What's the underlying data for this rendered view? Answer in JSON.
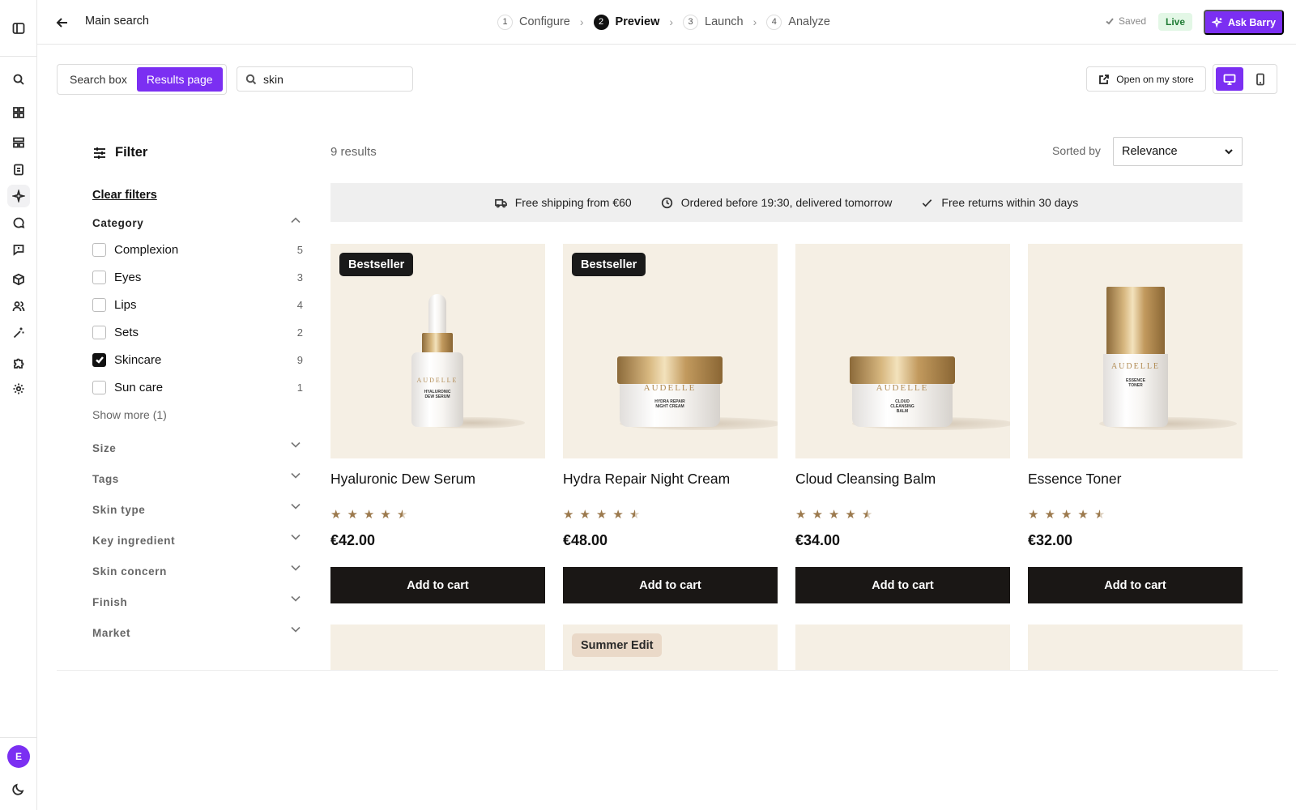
{
  "header": {
    "title": "Main search",
    "steps": [
      {
        "num": "1",
        "label": "Configure"
      },
      {
        "num": "2",
        "label": "Preview"
      },
      {
        "num": "3",
        "label": "Launch"
      },
      {
        "num": "4",
        "label": "Analyze"
      }
    ],
    "saved": "Saved",
    "live": "Live",
    "ask": "Ask Barry"
  },
  "toolbar": {
    "tabs": [
      "Search box",
      "Results page"
    ],
    "search_value": "skin",
    "open_store": "Open on my store"
  },
  "sidebar_icons": [
    "panel-icon",
    "search-icon",
    "dashboard-icon",
    "layout-icon",
    "clipboard-icon",
    "sparkle-icon",
    "chat-icon",
    "feedback-icon",
    "box-icon",
    "users-icon",
    "magic-wand-icon",
    "puzzle-icon",
    "gear-icon"
  ],
  "user": {
    "initial": "E"
  },
  "filters": {
    "title": "Filter",
    "clear": "Clear filters",
    "category": {
      "title": "Category",
      "options": [
        {
          "label": "Complexion",
          "count": "5",
          "checked": false
        },
        {
          "label": "Eyes",
          "count": "3",
          "checked": false
        },
        {
          "label": "Lips",
          "count": "4",
          "checked": false
        },
        {
          "label": "Sets",
          "count": "2",
          "checked": false
        },
        {
          "label": "Skincare",
          "count": "9",
          "checked": true
        },
        {
          "label": "Sun care",
          "count": "1",
          "checked": false
        }
      ],
      "show_more": "Show more (1)"
    },
    "collapsed": [
      "Size",
      "Tags",
      "Skin type",
      "Key ingredient",
      "Skin concern",
      "Finish",
      "Market"
    ]
  },
  "results": {
    "count": "9 results",
    "sort_label": "Sorted by",
    "sort_value": "Relevance"
  },
  "usp": [
    {
      "icon": "truck-icon",
      "text": "Free shipping from €60"
    },
    {
      "icon": "clock-icon",
      "text": "Ordered before 19:30, delivered tomorrow"
    },
    {
      "icon": "check-icon",
      "text": "Free returns within 30 days"
    }
  ],
  "products": [
    {
      "name": "Hyaluronic Dew Serum",
      "price": "€42.00",
      "badge": "Bestseller",
      "rating": 4.5,
      "brand": "AUDELLE",
      "label": "HYALURONIC DEW SERUM",
      "cta": "Add to cart"
    },
    {
      "name": "Hydra Repair Night Cream",
      "price": "€48.00",
      "badge": "Bestseller",
      "rating": 4.5,
      "brand": "AUDELLE",
      "label": "HYDRA REPAIR NIGHT CREAM",
      "cta": "Add to cart"
    },
    {
      "name": "Cloud Cleansing Balm",
      "price": "€34.00",
      "badge": "",
      "rating": 4.5,
      "brand": "AUDELLE",
      "label": "CLOUD CLEANSING BALM",
      "cta": "Add to cart"
    },
    {
      "name": "Essence Toner",
      "price": "€32.00",
      "badge": "",
      "rating": 4.5,
      "brand": "AUDELLE",
      "label": "ESSENCE TONER",
      "cta": "Add to cart"
    }
  ],
  "second_row_badges": [
    "",
    "Summer Edit",
    "",
    ""
  ],
  "colors": {
    "accent": "#7b2ff2",
    "live_bg": "#e3f7e6",
    "live_text": "#1e7a33",
    "star": "#9c7a4e",
    "card_bg": "#f5efe4",
    "button": "#1a1715"
  }
}
